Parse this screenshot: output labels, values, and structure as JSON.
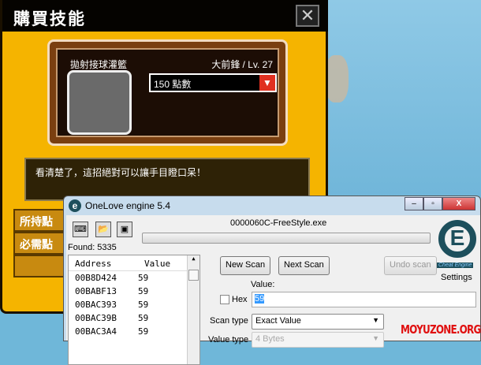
{
  "game": {
    "title": "購買技能",
    "close": "✕",
    "skill_name": "拋射接球灌籃",
    "position_level": "大前鋒 / Lv. 27",
    "price_select": "150 點數",
    "description": "看清楚了，這招絕對可以讓手目瞪口呆！",
    "held_points_label": "所持點",
    "required_points_label": "必需點"
  },
  "ce": {
    "title": "OneLove engine 5.4",
    "process": "0000060C-FreeStyle.exe",
    "found": "Found: 5335",
    "columns": [
      "Address",
      "Value"
    ],
    "rows": [
      [
        "00B8D424",
        "59"
      ],
      [
        "00BABF13",
        "59"
      ],
      [
        "00BAC393",
        "59"
      ],
      [
        "00BAC39B",
        "59"
      ],
      [
        "00BAC3A4",
        "59"
      ]
    ],
    "new_scan": "New Scan",
    "next_scan": "Next Scan",
    "undo_scan": "Undo scan",
    "value_label": "Value:",
    "hex_label": "Hex",
    "value": "59",
    "scan_type_label": "Scan type",
    "scan_type": "Exact Value",
    "value_type_label": "Value type",
    "value_type": "4 Bytes",
    "settings": "Settings",
    "logo_text": "Cheat Engine"
  },
  "watermark": "MOYUZONE.ORG"
}
